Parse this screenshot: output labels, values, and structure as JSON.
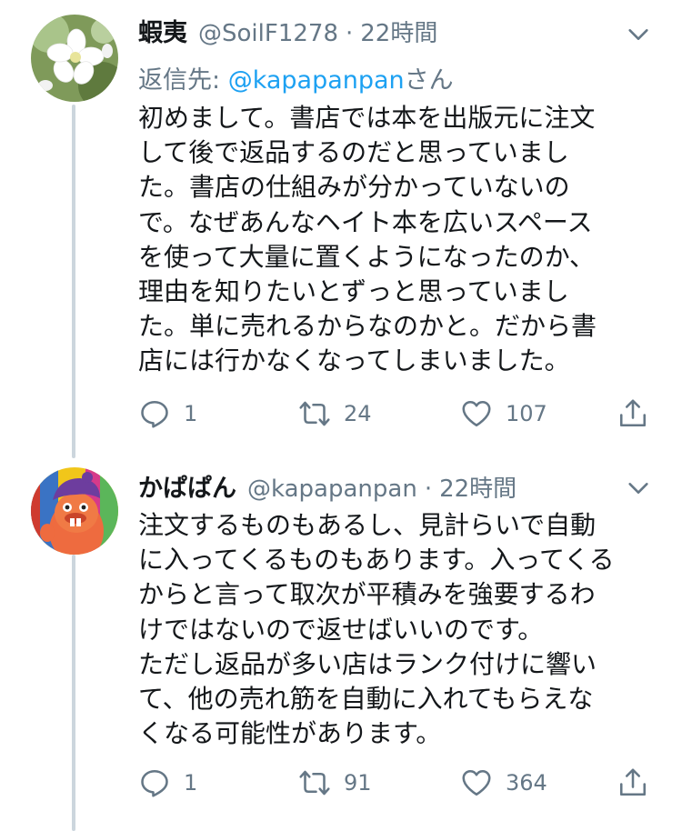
{
  "tweets": [
    {
      "display_name": "蝦夷",
      "handle": "@SoilF1278",
      "separator": "·",
      "time": "22時間",
      "reply_to_label": "返信先: ",
      "reply_to_handle": "@kapapanpan",
      "reply_to_suffix": "さん",
      "lines": [
        "初めまして。書店では本を出版元に注文",
        "して後で返品するのだと思っていまし",
        "た。書店の仕組みが分かっていないの",
        "で。なぜあんなヘイト本を広いスペース",
        "を使って大量に置くようになったのか、",
        "理由を知りたいとずっと思っていまし",
        "た。単に売れるからなのかと。だから書",
        "店には行かなくなってしまいました。"
      ],
      "replies": "1",
      "retweets": "24",
      "likes": "107",
      "avatar_icon": "apple-blossom-photo"
    },
    {
      "display_name": "かぱぱん",
      "handle": "@kapapanpan",
      "separator": "·",
      "time": "22時間",
      "lines": [
        "注文するものもあるし、見計らいで自動",
        "に入ってくるものもあります。入ってくる",
        "からと言って取次が平積みを強要するわ",
        "けではないので返せばいいのです。",
        "ただし返品が多い店はランク付けに響い",
        "て、他の売れ筋を自動に入れてもらえな",
        "くなる可能性があります。"
      ],
      "replies": "1",
      "retweets": "91",
      "likes": "364",
      "avatar_icon": "mascot-character-photo"
    }
  ],
  "icons": {
    "reply": "reply-icon",
    "retweet": "retweet-icon",
    "like": "heart-icon",
    "share": "share-icon",
    "more": "chevron-down-icon"
  },
  "colors": {
    "text": "#14171a",
    "secondary": "#657786",
    "link": "#1da1f2",
    "thread_line": "#ccd6dd"
  }
}
